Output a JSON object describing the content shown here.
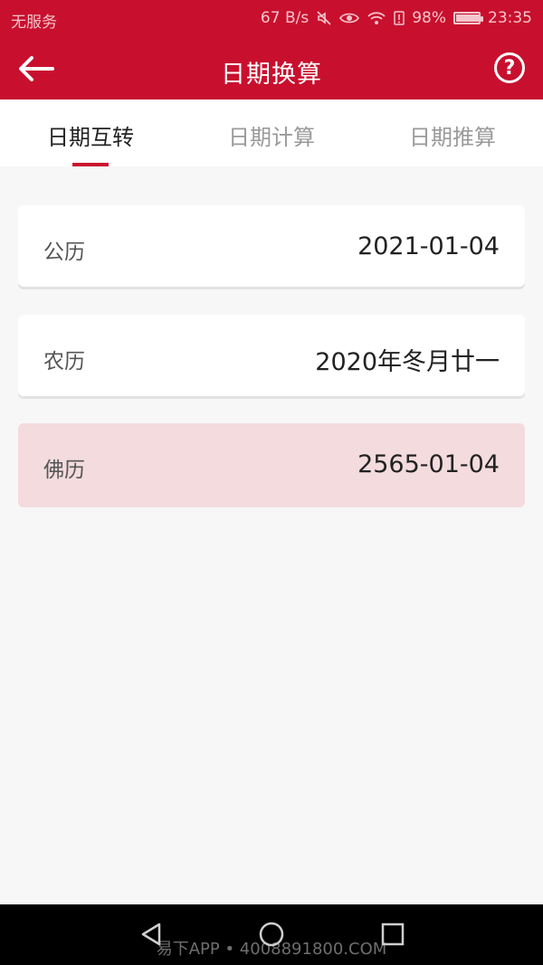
{
  "status_bar": {
    "carrier": "无服务",
    "speed": "67 B/s",
    "battery": "98%",
    "battery_level": 0.98,
    "time": "23:35"
  },
  "app_bar": {
    "title": "日期换算",
    "back_icon": "arrow-left-icon",
    "help_icon": "help-circle-icon",
    "help_glyph": "?"
  },
  "tabs": [
    {
      "label": "日期互转",
      "active": true
    },
    {
      "label": "日期计算",
      "active": false
    },
    {
      "label": "日期推算",
      "active": false
    }
  ],
  "cards": [
    {
      "label": "公历",
      "value": "2021-01-04"
    },
    {
      "label": "农历",
      "value": "2020年冬月廿一"
    },
    {
      "label": "佛历",
      "value": "2565-01-04"
    }
  ],
  "colors": {
    "accent": "#c8102e",
    "highlight_card": "#f3dbde"
  },
  "watermark": "易下APP • 4008891800.COM"
}
